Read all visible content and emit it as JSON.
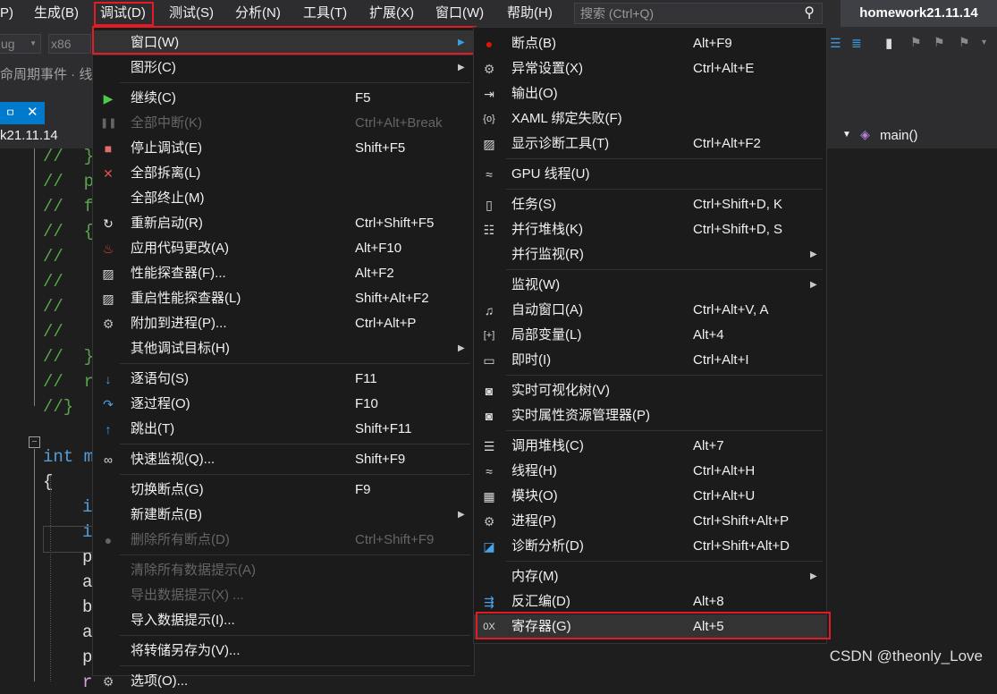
{
  "menubar": {
    "items": [
      "P)",
      "生成(B)",
      "调试(D)",
      "测试(S)",
      "分析(N)",
      "工具(T)",
      "扩展(X)",
      "窗口(W)",
      "帮助(H)"
    ],
    "search_placeholder": "搜索 (Ctrl+Q)",
    "solution_title": "homework21.11.14"
  },
  "toolbar": {
    "config": "ug",
    "platform": "x86"
  },
  "row3": {
    "text": "命周期事件 · 线"
  },
  "tab": {
    "pin": "ㅁ",
    "close": "✕"
  },
  "navbar": {
    "file": "k21.11.14",
    "member": "main()"
  },
  "code": {
    "lines": [
      {
        "text": "//  }",
        "color": "#57a64a",
        "indent": 1
      },
      {
        "text": "//  p",
        "color": "#57a64a",
        "indent": 1
      },
      {
        "text": "//  f",
        "color": "#57a64a",
        "indent": 1
      },
      {
        "text": "//  {",
        "color": "#57a64a",
        "indent": 1
      },
      {
        "text": "//",
        "color": "#57a64a",
        "indent": 1
      },
      {
        "text": "//",
        "color": "#57a64a",
        "indent": 1
      },
      {
        "text": "//",
        "color": "#57a64a",
        "indent": 1
      },
      {
        "text": "//",
        "color": "#57a64a",
        "indent": 1
      },
      {
        "text": "//  }",
        "color": "#57a64a",
        "indent": 1
      },
      {
        "text": "//  r",
        "color": "#57a64a",
        "indent": 1
      },
      {
        "text": "//}",
        "color": "#57a64a",
        "indent": 1
      },
      {
        "text": "",
        "color": "#dcdcdc",
        "indent": 0
      },
      {
        "text": "int m",
        "color": "#569cd6",
        "indent": 1
      },
      {
        "text": "{",
        "color": "#dcdcdc",
        "indent": 1
      },
      {
        "text": "i",
        "color": "#569cd6",
        "indent": 2
      },
      {
        "text": "i",
        "color": "#569cd6",
        "indent": 2
      },
      {
        "text": "p",
        "color": "#dcdcdc",
        "indent": 2
      },
      {
        "text": "a",
        "color": "#dcdcdc",
        "indent": 2
      },
      {
        "text": "b",
        "color": "#dcdcdc",
        "indent": 2
      },
      {
        "text": "a",
        "color": "#dcdcdc",
        "indent": 2
      },
      {
        "text": "p",
        "color": "#dcdcdc",
        "indent": 2
      },
      {
        "text": "r",
        "color": "#d8a0df",
        "indent": 2
      }
    ]
  },
  "debug_menu": {
    "items": [
      {
        "label": "窗口(W)",
        "shortcut": "",
        "arrow": true,
        "icon": "",
        "disabled": false,
        "highlight": true
      },
      {
        "label": "图形(C)",
        "shortcut": "",
        "arrow": true,
        "icon": "",
        "disabled": false
      },
      {
        "sep": true
      },
      {
        "label": "继续(C)",
        "shortcut": "F5",
        "icon": "play-icon",
        "disabled": false
      },
      {
        "label": "全部中断(K)",
        "shortcut": "Ctrl+Alt+Break",
        "icon": "pause-icon",
        "disabled": true
      },
      {
        "label": "停止调试(E)",
        "shortcut": "Shift+F5",
        "icon": "stop-icon",
        "disabled": false
      },
      {
        "label": "全部拆离(L)",
        "shortcut": "",
        "icon": "detach-x-icon",
        "disabled": false
      },
      {
        "label": "全部终止(M)",
        "shortcut": "",
        "icon": "",
        "disabled": false
      },
      {
        "label": "重新启动(R)",
        "shortcut": "Ctrl+Shift+F5",
        "icon": "restart-icon",
        "disabled": false
      },
      {
        "label": "应用代码更改(A)",
        "shortcut": "Alt+F10",
        "icon": "hot-reload-flame-icon",
        "disabled": false
      },
      {
        "label": "性能探查器(F)...",
        "shortcut": "Alt+F2",
        "icon": "profiler-icon",
        "disabled": false
      },
      {
        "label": "重启性能探查器(L)",
        "shortcut": "Shift+Alt+F2",
        "icon": "profiler-icon",
        "disabled": false
      },
      {
        "label": "附加到进程(P)...",
        "shortcut": "Ctrl+Alt+P",
        "icon": "gears-icon",
        "disabled": false
      },
      {
        "label": "其他调试目标(H)",
        "shortcut": "",
        "arrow": true,
        "icon": "",
        "disabled": false
      },
      {
        "sep": true
      },
      {
        "label": "逐语句(S)",
        "shortcut": "F11",
        "icon": "step-into-icon",
        "disabled": false
      },
      {
        "label": "逐过程(O)",
        "shortcut": "F10",
        "icon": "step-over-icon",
        "disabled": false
      },
      {
        "label": "跳出(T)",
        "shortcut": "Shift+F11",
        "icon": "step-out-icon",
        "disabled": false
      },
      {
        "sep": true
      },
      {
        "label": "快速监视(Q)...",
        "shortcut": "Shift+F9",
        "icon": "glasses-icon",
        "disabled": false
      },
      {
        "sep": true
      },
      {
        "label": "切换断点(G)",
        "shortcut": "F9",
        "icon": "",
        "disabled": false
      },
      {
        "label": "新建断点(B)",
        "shortcut": "",
        "arrow": true,
        "icon": "",
        "disabled": false
      },
      {
        "label": "删除所有断点(D)",
        "shortcut": "Ctrl+Shift+F9",
        "icon": "delete-breakpoints-icon",
        "disabled": true
      },
      {
        "sep": true
      },
      {
        "label": "清除所有数据提示(A)",
        "shortcut": "",
        "icon": "",
        "disabled": true
      },
      {
        "label": "导出数据提示(X) ...",
        "shortcut": "",
        "icon": "",
        "disabled": true
      },
      {
        "label": "导入数据提示(I)...",
        "shortcut": "",
        "icon": "",
        "disabled": false
      },
      {
        "sep": true
      },
      {
        "label": "将转储另存为(V)...",
        "shortcut": "",
        "icon": "",
        "disabled": false
      },
      {
        "sep": true
      },
      {
        "label": "选项(O)...",
        "shortcut": "",
        "icon": "gear-icon",
        "disabled": false
      }
    ]
  },
  "window_menu": {
    "items": [
      {
        "label": "断点(B)",
        "shortcut": "Alt+F9",
        "icon": "breakpoint-icon"
      },
      {
        "label": "异常设置(X)",
        "shortcut": "Ctrl+Alt+E",
        "icon": "exception-settings-icon"
      },
      {
        "label": "输出(O)",
        "shortcut": "",
        "icon": "output-icon"
      },
      {
        "label": "XAML 绑定失败(F)",
        "shortcut": "",
        "icon": "xaml-binding-icon"
      },
      {
        "label": "显示诊断工具(T)",
        "shortcut": "Ctrl+Alt+F2",
        "icon": "diagnostic-tools-icon"
      },
      {
        "sep": true
      },
      {
        "label": "GPU 线程(U)",
        "shortcut": "",
        "icon": "gpu-threads-icon"
      },
      {
        "sep": true
      },
      {
        "label": "任务(S)",
        "shortcut": "Ctrl+Shift+D, K",
        "icon": "tasks-icon"
      },
      {
        "label": "并行堆栈(K)",
        "shortcut": "Ctrl+Shift+D, S",
        "icon": "parallel-stacks-icon"
      },
      {
        "label": "并行监视(R)",
        "shortcut": "",
        "arrow": true,
        "icon": ""
      },
      {
        "sep": true
      },
      {
        "label": "监视(W)",
        "shortcut": "",
        "arrow": true,
        "icon": ""
      },
      {
        "label": "自动窗口(A)",
        "shortcut": "Ctrl+Alt+V, A",
        "icon": "autos-icon"
      },
      {
        "label": "局部变量(L)",
        "shortcut": "Alt+4",
        "icon": "locals-icon"
      },
      {
        "label": "即时(I)",
        "shortcut": "Ctrl+Alt+I",
        "icon": "immediate-icon"
      },
      {
        "sep": true
      },
      {
        "label": "实时可视化树(V)",
        "shortcut": "",
        "icon": "camera-icon"
      },
      {
        "label": "实时属性资源管理器(P)",
        "shortcut": "",
        "icon": "camera-icon"
      },
      {
        "sep": true
      },
      {
        "label": "调用堆栈(C)",
        "shortcut": "Alt+7",
        "icon": "call-stack-icon"
      },
      {
        "label": "线程(H)",
        "shortcut": "Ctrl+Alt+H",
        "icon": "threads-icon"
      },
      {
        "label": "模块(O)",
        "shortcut": "Ctrl+Alt+U",
        "icon": "modules-icon"
      },
      {
        "label": "进程(P)",
        "shortcut": "Ctrl+Shift+Alt+P",
        "icon": "processes-icon"
      },
      {
        "label": "诊断分析(D)",
        "shortcut": "Ctrl+Shift+Alt+D",
        "icon": "diagnostic-analysis-icon"
      },
      {
        "sep": true
      },
      {
        "label": "内存(M)",
        "shortcut": "",
        "arrow": true,
        "icon": ""
      },
      {
        "label": "反汇编(D)",
        "shortcut": "Alt+8",
        "icon": "disassembly-icon"
      },
      {
        "label": "寄存器(G)",
        "shortcut": "Alt+5",
        "icon": "registers-icon",
        "highlight": true
      }
    ]
  },
  "watermark": "CSDN @theonly_Love"
}
